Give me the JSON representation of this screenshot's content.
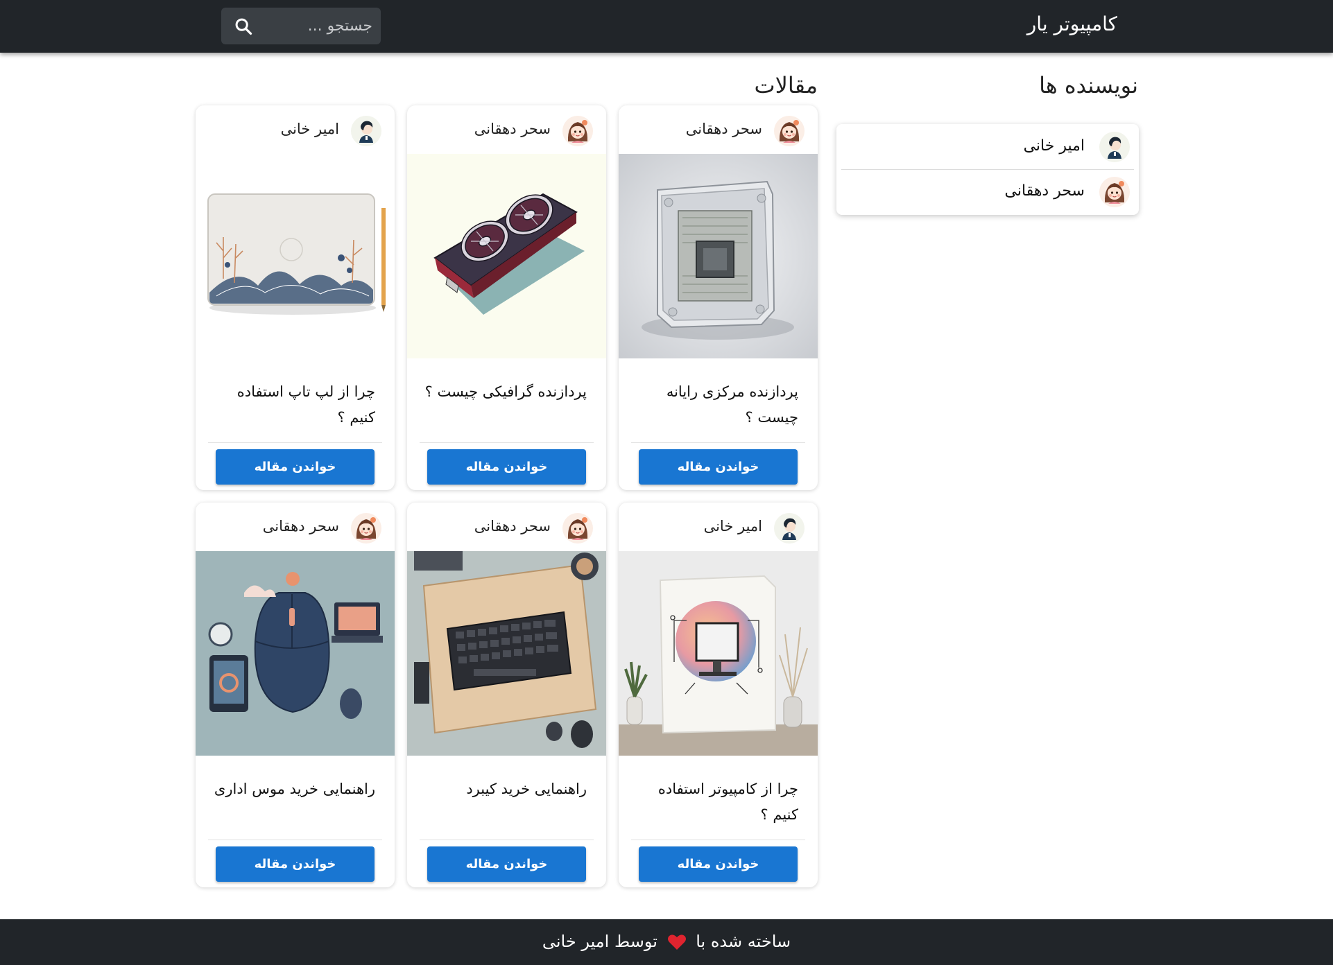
{
  "header": {
    "brand": "کامپیوتر یار",
    "search": {
      "placeholder": "جستجو ...",
      "value": "",
      "icon": "search-icon"
    }
  },
  "sections": {
    "writers_title": "نویسنده ها",
    "articles_title": "مقالات"
  },
  "writers": [
    {
      "name": "امیر خانی",
      "avatar": "male-avatar"
    },
    {
      "name": "سحر دهقانی",
      "avatar": "female-avatar"
    }
  ],
  "articles": [
    {
      "author": "سحر دهقانی",
      "avatar": "female-avatar",
      "image": "cpu-image",
      "title": "پردازنده مرکزی رایانه چیست ؟",
      "button": "خواندن مقاله"
    },
    {
      "author": "سحر دهقانی",
      "avatar": "female-avatar",
      "image": "gpu-image",
      "title": "پردازنده گرافیکی چیست ؟",
      "button": "خواندن مقاله"
    },
    {
      "author": "امیر خانی",
      "avatar": "male-avatar",
      "image": "laptop-image",
      "title": "چرا از لپ تاپ استفاده کنیم ؟",
      "button": "خواندن مقاله"
    },
    {
      "author": "امیر خانی",
      "avatar": "male-avatar",
      "image": "computer-image",
      "title": "چرا از کامپیوتر استفاده کنیم ؟",
      "button": "خواندن مقاله"
    },
    {
      "author": "سحر دهقانی",
      "avatar": "female-avatar",
      "image": "keyboard-image",
      "title": "راهنمایی خرید کیبرد",
      "button": "خواندن مقاله"
    },
    {
      "author": "سحر دهقانی",
      "avatar": "female-avatar",
      "image": "mouse-image",
      "title": "راهنمایی خرید موس اداری",
      "button": "خواندن مقاله"
    }
  ],
  "footer": {
    "prefix": "ساخته شده با",
    "icon": "heart-icon",
    "suffix": "توسط امیر خانی"
  },
  "colors": {
    "navbar": "#212529",
    "button": "#1976d2",
    "heart": "#e0242f"
  }
}
